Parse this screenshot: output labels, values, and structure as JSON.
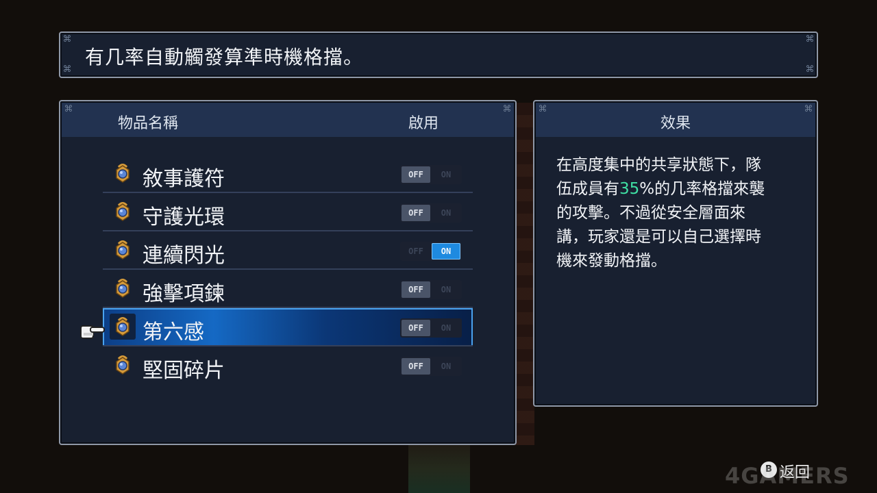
{
  "description": "有几率自動觸發算準時機格擋。",
  "list": {
    "col_name": "物品名稱",
    "col_enable": "啟用",
    "items": [
      {
        "label": "敘事護符",
        "enabled": false
      },
      {
        "label": "守護光環",
        "enabled": false
      },
      {
        "label": "連續閃光",
        "enabled": true
      },
      {
        "label": "強擊項鍊",
        "enabled": false
      },
      {
        "label": "第六感",
        "enabled": false,
        "selected": true
      },
      {
        "label": "堅固碎片",
        "enabled": false
      }
    ],
    "toggle_off": "OFF",
    "toggle_on": "ON"
  },
  "effect": {
    "title": "效果",
    "line1": "在高度集中的共享狀態下，隊",
    "line2_pre": "伍成員有",
    "line2_value": "35",
    "line2_post": "%的几率格擋來襲",
    "line3": "的攻擊。不過從安全層面來",
    "line4": "講，玩家還是可以自己選擇時",
    "line5": "機來發動格擋。"
  },
  "back": {
    "button": "B",
    "label": "返回"
  },
  "watermark": "4GAMERS",
  "colors": {
    "highlight": "#3fe0a4",
    "toggle_on": "#1e8ae0",
    "panel": "#182030"
  }
}
